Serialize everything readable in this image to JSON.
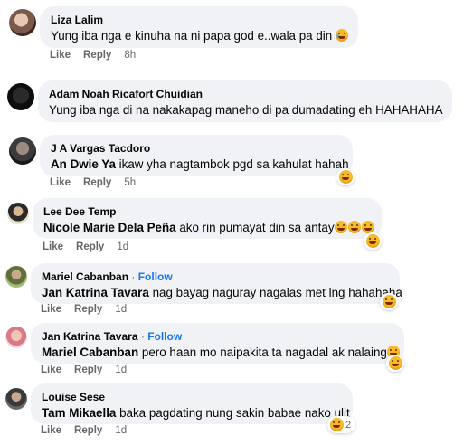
{
  "actions": {
    "like": "Like",
    "reply": "Reply"
  },
  "follow_label": "Follow",
  "follow_sep": "·",
  "comments": [
    {
      "author": "Liza Lalim",
      "text": "Yung iba nga e kinuha na ni papa god e..wala pa din",
      "time": "8h",
      "emoji": "crying-face"
    },
    {
      "author": "Adam Noah Ricafort Chuidian",
      "text": "Yung iba nga di na nakakapag maneho di pa dumadating eh HAHAHAHA",
      "time": ""
    },
    {
      "author": "J A Vargas Tacdoro",
      "mention": "An Dwie Ya",
      "text": " ikaw yha nagtambok pgd sa kahulat hahah",
      "time": "5h",
      "reaction": "haha"
    },
    {
      "author": "Lee Dee Temp",
      "mention": "Nicole Marie Dela Peña",
      "text": " ako rin pumayat din sa antay",
      "time": "1d",
      "reaction": "haha"
    },
    {
      "author": "Mariel Cabanban",
      "follow": true,
      "mention": "Jan Katrina Tavara",
      "text": " nag bayag naguray nagalas met lng hahahaha",
      "time": "1d",
      "reaction": "haha"
    },
    {
      "author": "Jan Katrina Tavara",
      "follow": true,
      "mention": "Mariel Cabanban",
      "text": " pero haan mo naipakita ta nagadal ak nalaing",
      "time": "1d",
      "reaction": "haha"
    },
    {
      "author": "Louise Sese",
      "mention": "Tam Mikaella",
      "text": " baka pagdating nung sakin babae nako ulit",
      "time": "1d",
      "reaction": "haha",
      "reaction_count": "2"
    }
  ],
  "colors": {
    "bubble": "#f0f2f5",
    "follow": "#1877f2",
    "meta": "#65676b"
  }
}
